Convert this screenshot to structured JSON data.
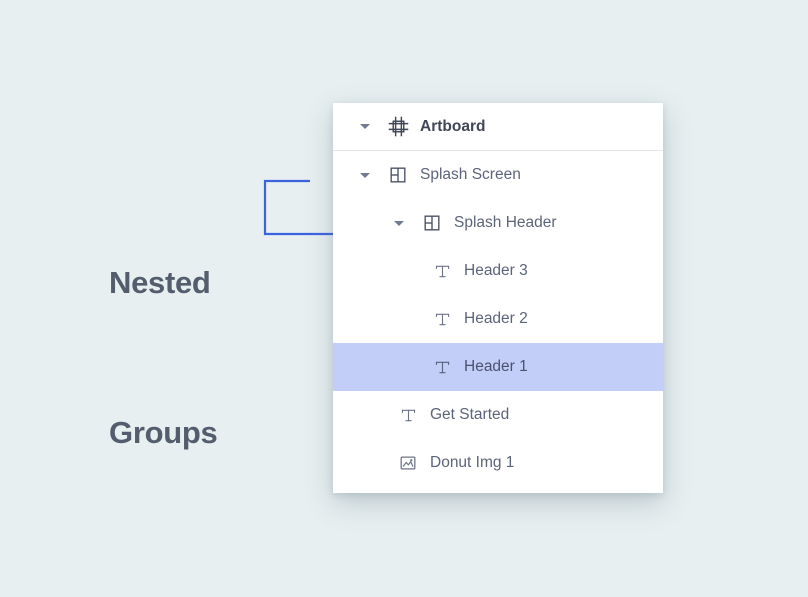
{
  "annotation": {
    "label_line1": "Nested",
    "label_line2": "Groups",
    "connector_color": "#3a63e0",
    "text_color": "#535d6d"
  },
  "theme": {
    "background": "#e7eff0",
    "panel_background": "#ffffff",
    "selection_background": "#c2cdf8",
    "row_text_color": "#5c6479",
    "divider_color": "#e3e5ec"
  },
  "layers_panel": {
    "rows": [
      {
        "label": "Artboard",
        "icon": "artboard-icon",
        "depth": 0,
        "expanded": true,
        "has_disclosure": true,
        "selected": false,
        "bold": true,
        "divider_below": true
      },
      {
        "label": "Splash Screen",
        "icon": "group-icon",
        "depth": 0,
        "expanded": true,
        "has_disclosure": true,
        "selected": false,
        "bold": false,
        "divider_below": false
      },
      {
        "label": "Splash Header",
        "icon": "group-icon",
        "depth": 1,
        "expanded": true,
        "has_disclosure": true,
        "selected": false,
        "bold": false,
        "divider_below": false
      },
      {
        "label": "Header 3",
        "icon": "text-icon",
        "depth": 2,
        "expanded": false,
        "has_disclosure": false,
        "selected": false,
        "bold": false,
        "divider_below": false
      },
      {
        "label": "Header 2",
        "icon": "text-icon",
        "depth": 2,
        "expanded": false,
        "has_disclosure": false,
        "selected": false,
        "bold": false,
        "divider_below": false
      },
      {
        "label": "Header 1",
        "icon": "text-icon",
        "depth": 2,
        "expanded": false,
        "has_disclosure": false,
        "selected": true,
        "bold": false,
        "divider_below": false
      },
      {
        "label": "Get Started",
        "icon": "text-icon",
        "depth": 1,
        "expanded": false,
        "has_disclosure": false,
        "selected": false,
        "bold": false,
        "divider_below": false
      },
      {
        "label": "Donut Img 1",
        "icon": "image-icon",
        "depth": 1,
        "expanded": false,
        "has_disclosure": false,
        "selected": false,
        "bold": false,
        "divider_below": false
      }
    ]
  }
}
